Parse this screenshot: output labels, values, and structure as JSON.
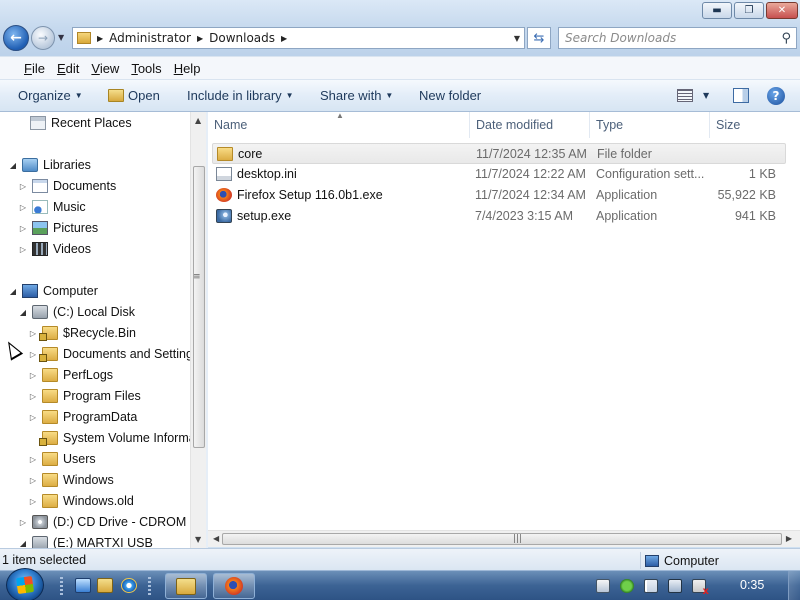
{
  "address_bar": {
    "crumbs": [
      "Administrator",
      "Downloads"
    ]
  },
  "search": {
    "placeholder": "Search Downloads"
  },
  "menu": {
    "items": [
      {
        "label": "File",
        "accel": "F",
        "rest": "ile"
      },
      {
        "label": "Edit",
        "accel": "E",
        "rest": "dit"
      },
      {
        "label": "View",
        "accel": "V",
        "rest": "iew"
      },
      {
        "label": "Tools",
        "accel": "T",
        "rest": "ools"
      },
      {
        "label": "Help",
        "accel": "H",
        "rest": "elp"
      }
    ]
  },
  "toolbar": {
    "organize": "Organize",
    "open": "Open",
    "include_in_library": "Include in library",
    "share_with": "Share with",
    "new_folder": "New folder"
  },
  "navigation": {
    "recent_places": "Recent Places",
    "libraries": "Libraries",
    "library_items": [
      "Documents",
      "Music",
      "Pictures",
      "Videos"
    ],
    "computer": "Computer",
    "local_disk": "(C:) Local Disk",
    "c_folders": [
      "$Recycle.Bin",
      "Documents and Settings",
      "PerfLogs",
      "Program Files",
      "ProgramData",
      "System Volume Informa",
      "Users",
      "Windows",
      "Windows.old"
    ],
    "cd_drive": "(D:) CD Drive - CDROM",
    "usb_drive": "(E:) MARTXI USB"
  },
  "columns": {
    "name": "Name",
    "date_modified": "Date modified",
    "type": "Type",
    "size": "Size"
  },
  "files": [
    {
      "name": "core",
      "date": "11/7/2024 12:35 AM",
      "type": "File folder",
      "size": "",
      "icon": "folder-icon",
      "selected": true
    },
    {
      "name": "desktop.ini",
      "date": "11/7/2024 12:22 AM",
      "type": "Configuration sett...",
      "size": "1 KB",
      "icon": "config-file-icon",
      "selected": false
    },
    {
      "name": "Firefox Setup 116.0b1.exe",
      "date": "11/7/2024 12:34 AM",
      "type": "Application",
      "size": "55,922 KB",
      "icon": "firefox-icon",
      "selected": false
    },
    {
      "name": "setup.exe",
      "date": "7/4/2023 3:15 AM",
      "type": "Application",
      "size": "941 KB",
      "icon": "setup-icon",
      "selected": false
    }
  ],
  "status": {
    "selection": "1 item selected",
    "location": "Computer"
  },
  "taskbar": {
    "clock": "0:35"
  },
  "colors": {
    "chrome": "#c6d9ee",
    "taskbar": "#3c6394",
    "selection": "#e9e9e9"
  }
}
